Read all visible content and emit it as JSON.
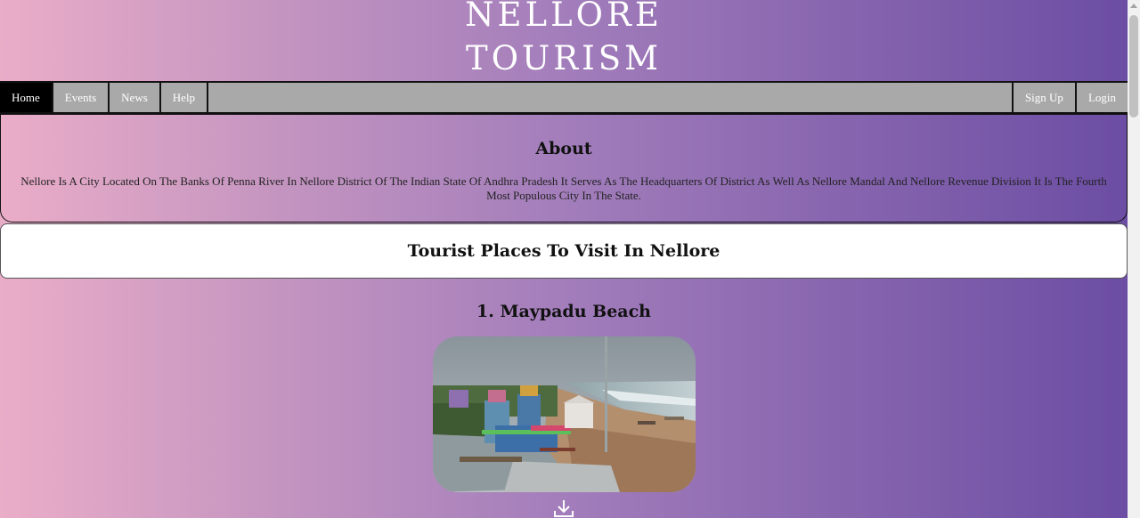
{
  "logo": {
    "line1": "NELLORE",
    "line2": "TOURISM"
  },
  "nav": {
    "left": [
      "Home",
      "Events",
      "News",
      "Help"
    ],
    "right": [
      "Sign Up",
      "Login"
    ],
    "active": "Home"
  },
  "about": {
    "title": "About",
    "text": "Nellore Is A City Located On The Banks Of Penna River In Nellore District Of The Indian State Of Andhra Pradesh It Serves As The Headquarters Of District As Well As Nellore Mandal And Nellore Revenue Division It Is The Fourth Most Populous City In The State."
  },
  "places": {
    "heading": "Tourist Places To Visit In Nellore",
    "items": [
      {
        "title": "1. Maypadu Beach"
      }
    ]
  },
  "icons": {
    "download": "download-icon",
    "scroll_up": "chevron-up-icon"
  },
  "colors": {
    "gradient_start": "#eaadc8",
    "gradient_end": "#6a4ca3",
    "nav_bg": "#a9a9a9",
    "nav_active": "#000000"
  }
}
